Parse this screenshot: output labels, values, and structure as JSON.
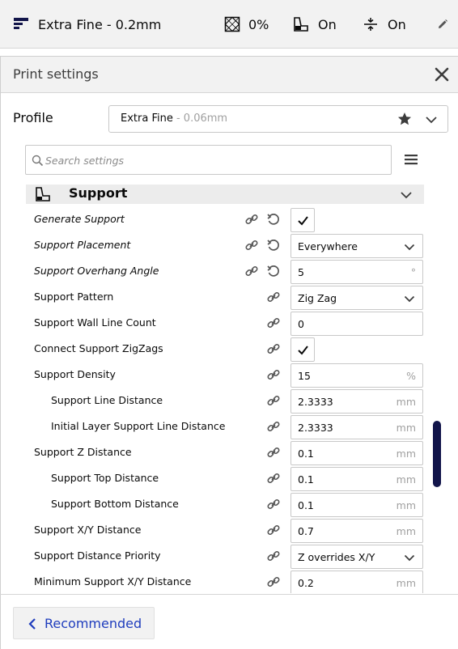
{
  "topbar": {
    "profile_name": "Extra Fine - 0.2mm",
    "infill": "0%",
    "support": "On",
    "adhesion": "On"
  },
  "panel": {
    "title": "Print settings",
    "profile_label": "Profile",
    "profile_value": "Extra Fine",
    "profile_layer": " - 0.06mm",
    "search_placeholder": "Search settings",
    "category": "Support"
  },
  "settings": [
    {
      "label": "Generate Support",
      "value": "",
      "unit": ""
    },
    {
      "label": "Support Placement",
      "value": "Everywhere",
      "unit": ""
    },
    {
      "label": "Support Overhang Angle",
      "value": "5",
      "unit": "°"
    },
    {
      "label": "Support Pattern",
      "value": "Zig Zag",
      "unit": ""
    },
    {
      "label": "Support Wall Line Count",
      "value": "0",
      "unit": ""
    },
    {
      "label": "Connect Support ZigZags",
      "value": "",
      "unit": ""
    },
    {
      "label": "Support Density",
      "value": "15",
      "unit": "%"
    },
    {
      "label": "Support Line Distance",
      "value": "2.3333",
      "unit": "mm"
    },
    {
      "label": "Initial Layer Support Line Distance",
      "value": "2.3333",
      "unit": "mm"
    },
    {
      "label": "Support Z Distance",
      "value": "0.1",
      "unit": "mm"
    },
    {
      "label": "Support Top Distance",
      "value": "0.1",
      "unit": "mm"
    },
    {
      "label": "Support Bottom Distance",
      "value": "0.1",
      "unit": "mm"
    },
    {
      "label": "Support X/Y Distance",
      "value": "0.7",
      "unit": "mm"
    },
    {
      "label": "Support Distance Priority",
      "value": "Z overrides X/Y",
      "unit": ""
    },
    {
      "label": "Minimum Support X/Y Distance",
      "value": "0.2",
      "unit": "mm"
    }
  ],
  "footer": {
    "recommended_label": "Recommended"
  },
  "colors": {
    "accent": "#1f3dbd",
    "scrollbar": "#12154a",
    "header_bg": "#f2f2f2"
  }
}
